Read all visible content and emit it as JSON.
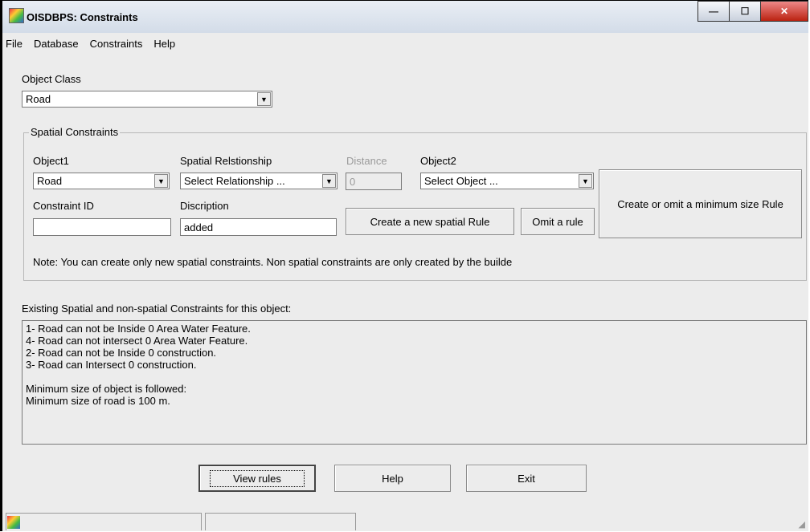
{
  "window": {
    "title": "OISDBPS: Constraints"
  },
  "menu": [
    "File",
    "Database",
    "Constraints",
    "Help"
  ],
  "object_class": {
    "label": "Object Class",
    "value": "Road"
  },
  "spatial": {
    "legend": "Spatial Constraints",
    "object1_label": "Object1",
    "object1_value": "Road",
    "relationship_label": "Spatial Relstionship",
    "relationship_value": "Select Relationship ...",
    "distance_label": "Distance",
    "distance_value": "0",
    "object2_label": "Object2",
    "object2_value": "Select Object ...",
    "constraint_id_label": "Constraint ID",
    "constraint_id_value": "",
    "description_label": "Discription",
    "description_value": "added",
    "create_rule_button": "Create a new spatial Rule",
    "omit_rule_button": "Omit a rule",
    "min_size_button": "Create or omit a minimum size  Rule",
    "note": "Note: You can create only new spatial  constraints. Non spatial constraints are only created by the builde"
  },
  "existing": {
    "label": "Existing Spatial and non-spatial Constraints for this object:",
    "lines": [
      "1- Road can not be Inside 0 Area Water Feature.",
      "4- Road can not intersect 0 Area Water Feature.",
      "2- Road can not be Inside 0 construction.",
      "3- Road can Intersect 0 construction.",
      "",
      "Minimum size of object is followed:",
      "Minimum size of road is 100  m."
    ]
  },
  "buttons": {
    "view_rules": "View rules",
    "help": "Help",
    "exit": "Exit"
  },
  "icons": [
    "app-icon",
    "minimize-icon",
    "maximize-icon",
    "close-icon",
    "dropdown-arrow-icon",
    "status-app-icon",
    "resize-grip-icon"
  ]
}
